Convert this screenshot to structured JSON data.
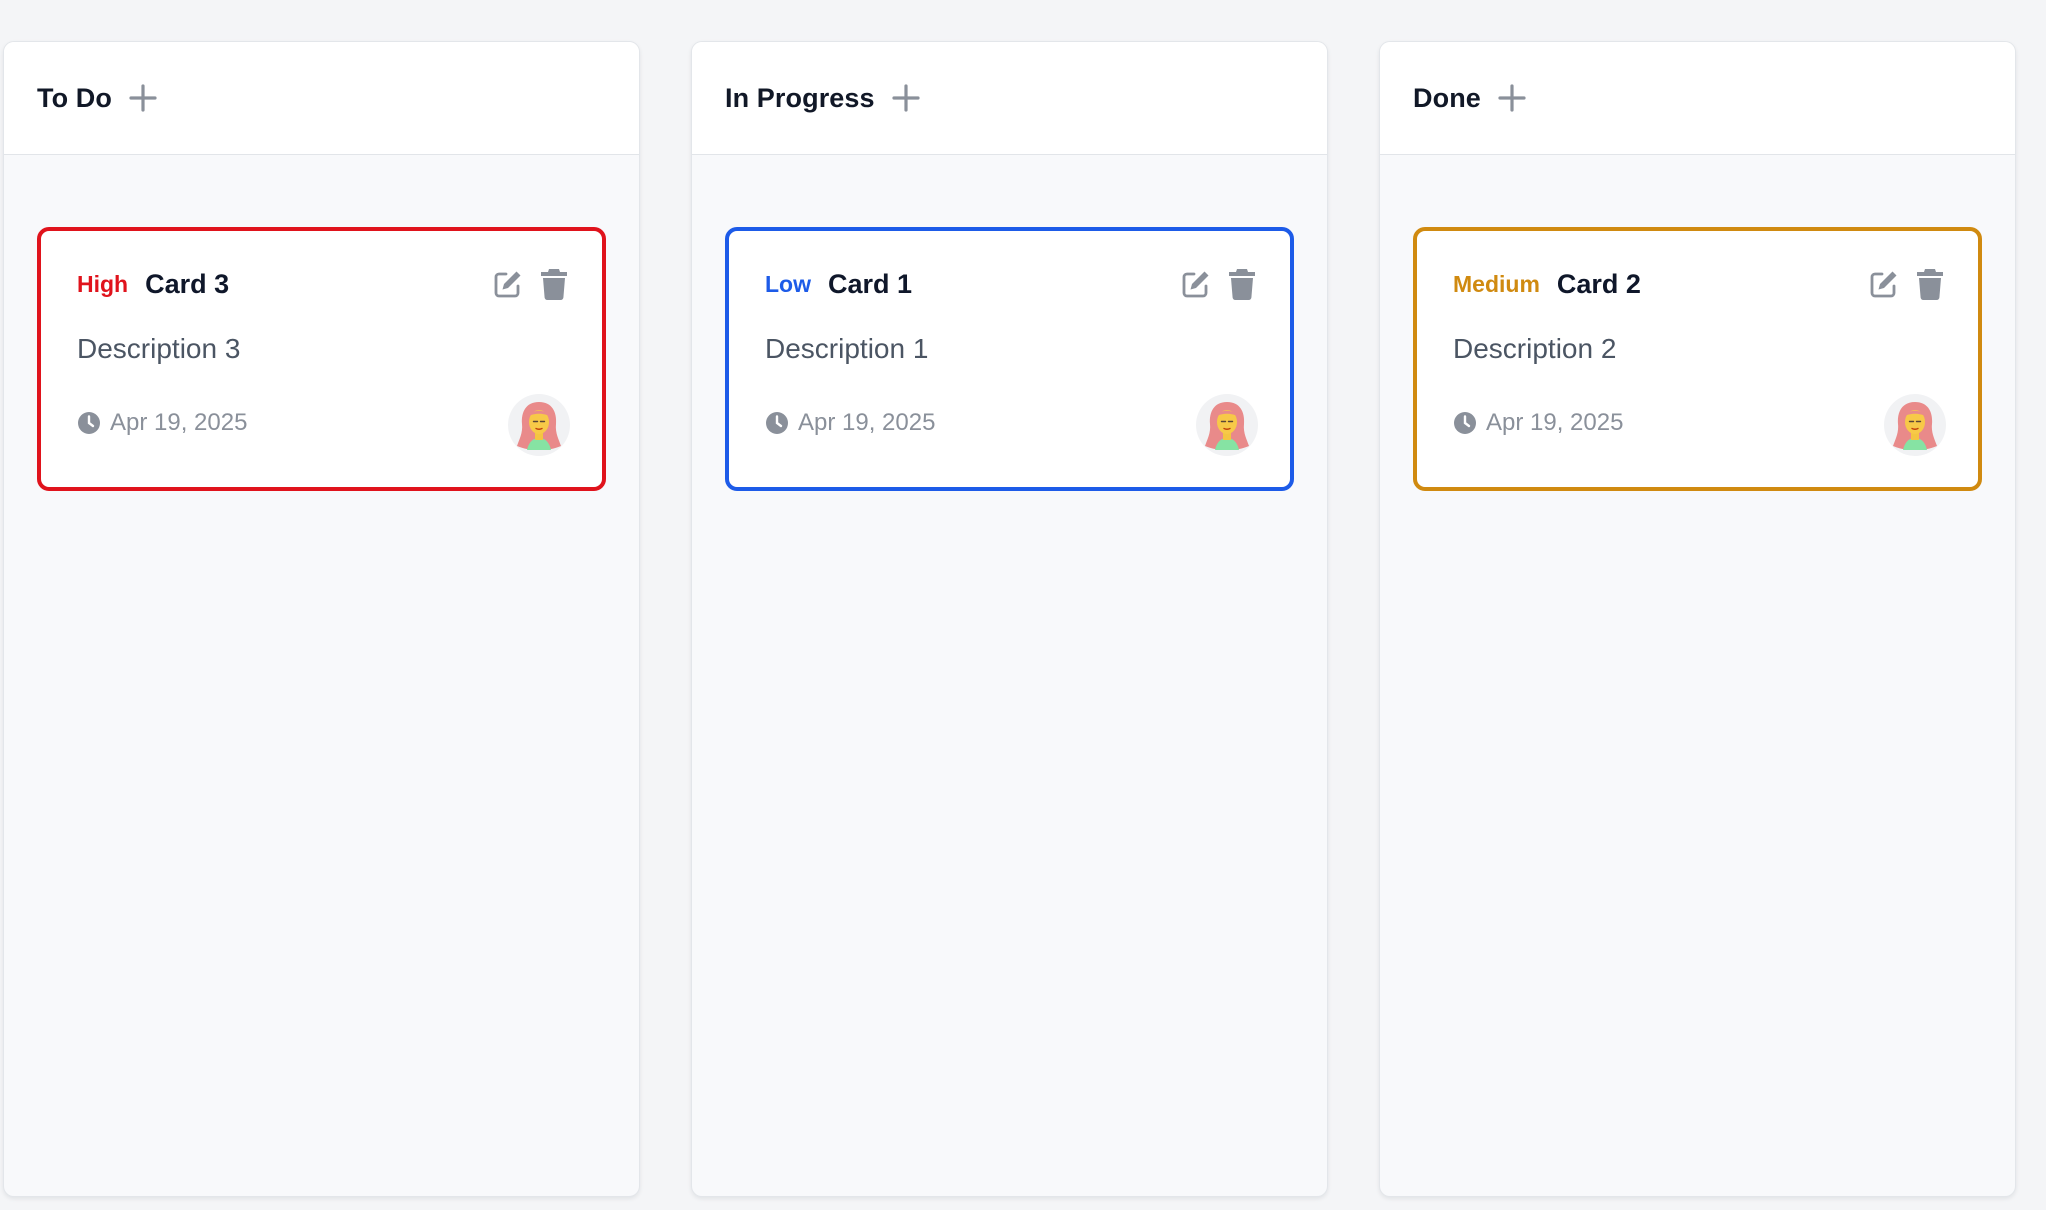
{
  "columns": [
    {
      "title": "To Do",
      "cards": [
        {
          "priority": "High",
          "priority_color": "#e0131c",
          "title": "Card 3",
          "description": "Description 3",
          "date": "Apr 19, 2025"
        }
      ]
    },
    {
      "title": "In Progress",
      "cards": [
        {
          "priority": "Low",
          "priority_color": "#1d5be8",
          "title": "Card 1",
          "description": "Description 1",
          "date": "Apr 19, 2025"
        }
      ]
    },
    {
      "title": "Done",
      "cards": [
        {
          "priority": "Medium",
          "priority_color": "#d08a10",
          "title": "Card 2",
          "description": "Description 2",
          "date": "Apr 19, 2025"
        }
      ]
    }
  ],
  "icons": {
    "add": "plus-icon",
    "edit": "edit-icon",
    "delete": "trash-icon",
    "date": "clock-icon",
    "assignee": "avatar"
  },
  "colors": {
    "icon_gray": "#8a909a",
    "page_bg": "#f4f5f7",
    "column_bg": "#f8f9fb"
  }
}
